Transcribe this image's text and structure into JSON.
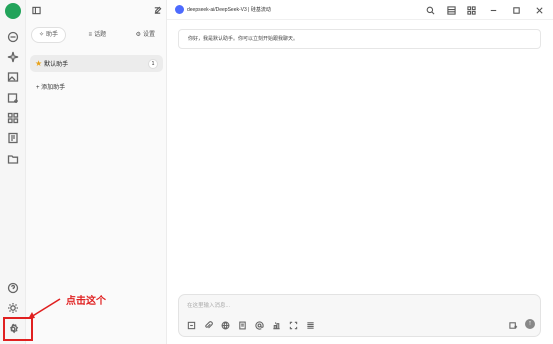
{
  "rail": {
    "items": [
      "avatar",
      "chat-icon",
      "sparkle-icon",
      "image-icon",
      "add-image-icon",
      "apps-icon",
      "knowledge-icon",
      "folder-icon"
    ],
    "bottom": [
      "help-icon",
      "theme-icon",
      "settings-icon"
    ]
  },
  "panel": {
    "tabs": [
      {
        "icon": "✧",
        "label": "助手"
      },
      {
        "icon": "≡",
        "label": "话题"
      },
      {
        "icon": "⚙",
        "label": "设置"
      }
    ],
    "assistant": {
      "label": "默认助手",
      "count": "1"
    },
    "add_label": "+ 添加助手"
  },
  "topbar": {
    "title": "deepseek-ai/DeepSeek-V3 | 硅基流动"
  },
  "chat": {
    "greeting": "你好，我是默认助手。你可以立刻开始跟我聊天。"
  },
  "input": {
    "placeholder": "在这里输入消息..."
  },
  "annotation": {
    "text": "点击这个"
  },
  "colors": {
    "accent": "#22a35a",
    "annotation": "#e02020",
    "deepseek": "#4d6bfe"
  }
}
